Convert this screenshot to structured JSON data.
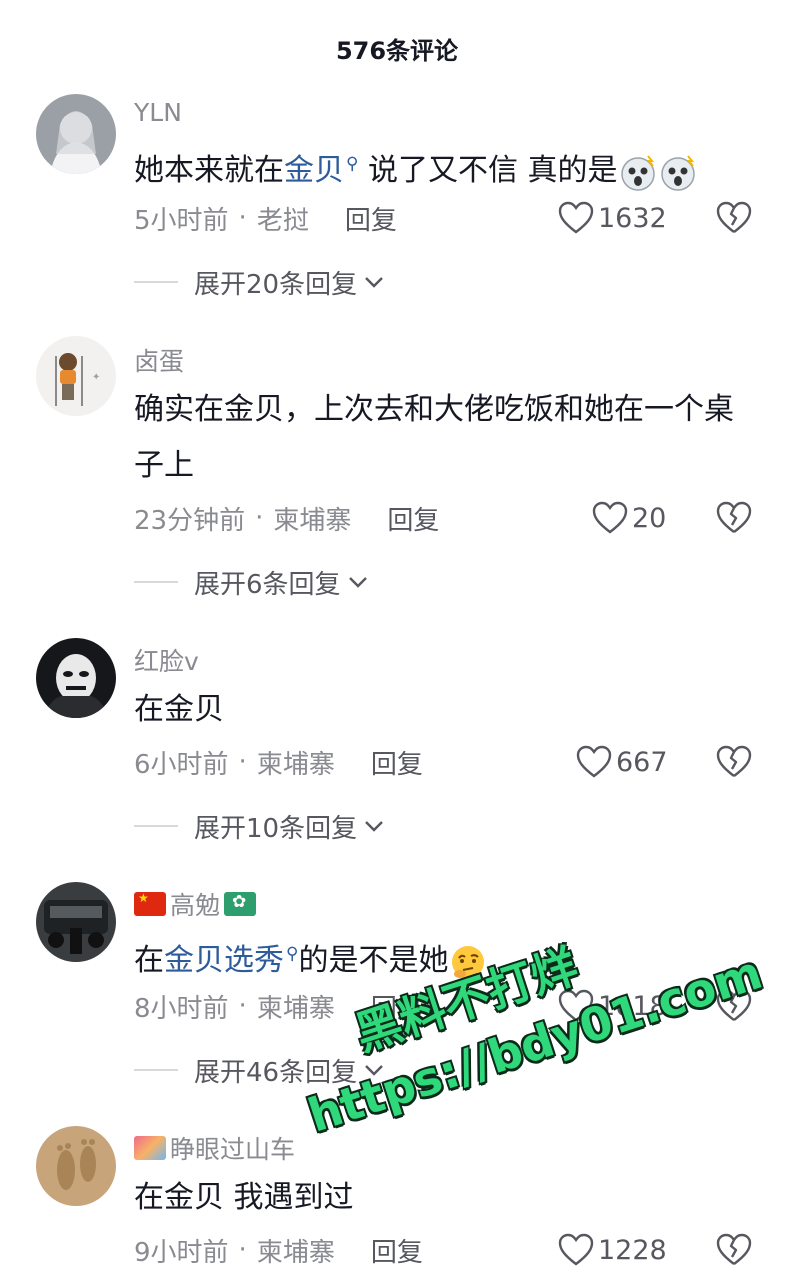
{
  "header": {
    "title": "576条评论"
  },
  "comments": [
    {
      "username": "YLN",
      "text_before": "她本来就在",
      "link": "金贝",
      "text_after": " 说了又不信 真的是",
      "time": "5小时前",
      "location": "老挝",
      "reply": "回复",
      "likes": "1632",
      "expand": "展开20条回复"
    },
    {
      "username": "卤蛋",
      "text": "确实在金贝，上次去和大佬吃饭和她在一个桌子上",
      "time": "23分钟前",
      "location": "柬埔寨",
      "reply": "回复",
      "likes": "20",
      "expand": "展开6条回复"
    },
    {
      "username": "红脸v",
      "text": "在金贝",
      "time": "6小时前",
      "location": "柬埔寨",
      "reply": "回复",
      "likes": "667",
      "expand": "展开10条回复"
    },
    {
      "username": "高勉",
      "text_before": "在",
      "link": "金贝选秀",
      "text_after": "的是不是她",
      "time": "8小时前",
      "location": "柬埔寨",
      "reply": "回复",
      "likes": "1018",
      "expand": "展开46条回复"
    },
    {
      "username": "睁眼过山车",
      "text": "在金贝 我遇到过",
      "time": "9小时前",
      "location": "柬埔寨",
      "reply": "回复",
      "likes": "1228"
    }
  ],
  "watermark": {
    "line1": "黑料不打烊",
    "line2": "https://bdy01.com"
  },
  "colors": {
    "link": "#2d5b9b",
    "meta": "#8a8b91",
    "watermark": "#2fd87a"
  }
}
